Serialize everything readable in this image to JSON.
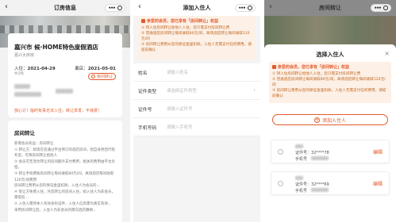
{
  "screen1": {
    "title": "订房信息",
    "hotel_name": "嘉兴市 候·HOME特色度假酒店",
    "address": "嘉兴大床房",
    "checkin_label": "入住：",
    "checkin_date": "2021-04-29",
    "checkout_label": "离店：",
    "checkout_date": "2021-05-01",
    "nights": "共2晚",
    "transfer_button": "房间转让",
    "tip": "放心订！临时有事无法入住，转让享发，不浪费！",
    "rules_title": "房间转让",
    "rules": [
      "新增会员权益：房间转让",
      "① 转让方：如现在您通过平台预订的酒店房间，因自身原因行程有变，可将房间转让给他人",
      "② 会员可无须为转让的房间额外支付费用，相关的费用由平台负担，",
      "③ 转让手续费按房间转让每间收取80元/间，离场酒店每间收取120元/间费用",
      "房间转让费用从您的保证金里扣除，入住人为会员的...",
      "④ 受让方免费入住，凭您转让的房间入住，如入住人为非会员，需提前...",
      "⑤ 入住人需持本人有效身份证件，入住人信息需为真实有效...",
      "采用房间转让后，入住人为非会员的需向酒店缴纳..."
    ]
  },
  "screen2": {
    "title": "添加入住人",
    "notice_title": "亲爱的会员，您已享有「房间转让」权益",
    "notice_items": [
      "① 持入住房间转让给他人入住，您只需支付房间转让费",
      "② 普通酒店房间转让每间收取80元/间，离场酒店转让每间收取120元/间",
      "③ 房间转让费用从您的保证金里扣除，入住人无需支付任何费用，请提前确认"
    ],
    "form": [
      {
        "label": "姓名",
        "placeholder": "请输入姓名",
        "has_arrow": false
      },
      {
        "label": "证件类型",
        "placeholder": "请选择证件类型",
        "has_arrow": true
      },
      {
        "label": "证件号",
        "placeholder": "请输入证件号",
        "has_arrow": false
      },
      {
        "label": "手机号码",
        "placeholder": "请输入手机号",
        "has_arrow": false
      }
    ]
  },
  "screen3": {
    "title": "房间转让",
    "sheet_title": "选择入住人",
    "close_glyph": "×",
    "notice_title": "亲爱的会员，您已享有「房间转让」权益",
    "notice_items": [
      "① 持入住房间转让给他人入住，您只需支付房间转让费",
      "② 普通酒店房间转让每间收取80元/间，离场酒店转让每间收取120元/间",
      "③ 房间转让费用从您的保证金里扣除，入住人无需支付任何费用，请提前确认"
    ],
    "add_button": "添加入住人",
    "guests": [
      {
        "id_label": "证件号：",
        "id_value": "32****78",
        "phone_label": "手机号",
        "edit": "编辑"
      },
      {
        "id_label": "证件号：",
        "id_value": "32****69",
        "phone_label": "手机号",
        "edit": "编辑"
      }
    ]
  },
  "icons": {
    "back": "‹",
    "accent": "#e25a2b"
  }
}
